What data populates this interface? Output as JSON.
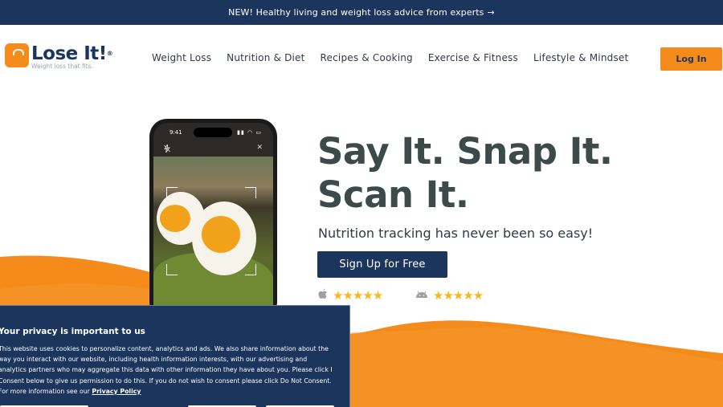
{
  "banner": {
    "text": "NEW! Healthy living and weight loss advice from experts",
    "arrow": "→"
  },
  "logo": {
    "name": "Lose It!",
    "mark": "®",
    "tagline": "Weight loss that fits."
  },
  "nav": {
    "items": [
      {
        "label": "Weight Loss"
      },
      {
        "label": "Nutrition & Diet"
      },
      {
        "label": "Recipes & Cooking"
      },
      {
        "label": "Exercise & Fitness"
      },
      {
        "label": "Lifestyle & Mindset"
      }
    ],
    "login_label": "Log In"
  },
  "phone": {
    "time": "9:41",
    "signals": "▮▮ ◠ ▭",
    "flash_icon": "flash-off-icon",
    "close_icon": "✕"
  },
  "hero": {
    "title_line1": "Say It. Snap It.",
    "title_line2": "Scan It.",
    "subtitle": "Nutrition tracking has never been so easy!",
    "cta_label": "Sign Up for Free"
  },
  "ratings": {
    "ios": {
      "icon": "apple-icon",
      "stars": "★★★★★",
      "rating": 4.8
    },
    "android": {
      "icon": "android-icon",
      "stars": "★★★★★",
      "rating": 4.6
    }
  },
  "privacy": {
    "title": "Your privacy is important to us",
    "body": "This website uses cookies to personalize content, analytics and ads. We also share information about the way you interact with our website, including health information interests, with our advertising and analytics partners who may aggregate this data with other information they have about you. Please click I Consent below to give us permission to do this. If you do not wish to consent please click Do Not Consent. For more information see our",
    "link": "Privacy Policy"
  },
  "colors": {
    "navy": "#1b355d",
    "orange": "#f48b1b",
    "star": "#f5b81e",
    "text": "#2d3b45"
  }
}
